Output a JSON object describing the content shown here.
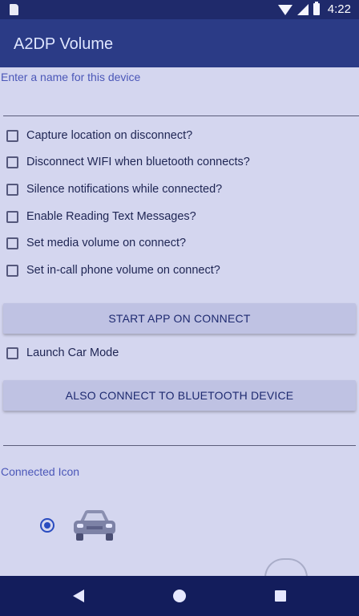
{
  "status_bar": {
    "time": "4:22",
    "battery_level": "charging"
  },
  "app_bar": {
    "title": "A2DP Volume"
  },
  "name_field": {
    "placeholder": "Enter a name for this device",
    "value": ""
  },
  "checkboxes": [
    {
      "label": "Capture location on disconnect?",
      "checked": false
    },
    {
      "label": "Disconnect WIFI when bluetooth connects?",
      "checked": false
    },
    {
      "label": "Silence notifications while connected?",
      "checked": false
    },
    {
      "label": "Enable Reading Text Messages?",
      "checked": false
    },
    {
      "label": "Set media volume on connect?",
      "checked": false
    },
    {
      "label": "Set in-call phone volume on connect?",
      "checked": false
    }
  ],
  "start_app_button": "START APP ON CONNECT",
  "car_mode": {
    "label": "Launch Car Mode",
    "checked": false
  },
  "also_connect_button": "ALSO CONNECT TO BLUETOOTH DEVICE",
  "connected_icon": {
    "label": "Connected Icon",
    "selected_icon": "car-icon"
  },
  "navigation": {
    "back": "back-icon",
    "home": "home-icon",
    "recents": "recents-icon"
  }
}
